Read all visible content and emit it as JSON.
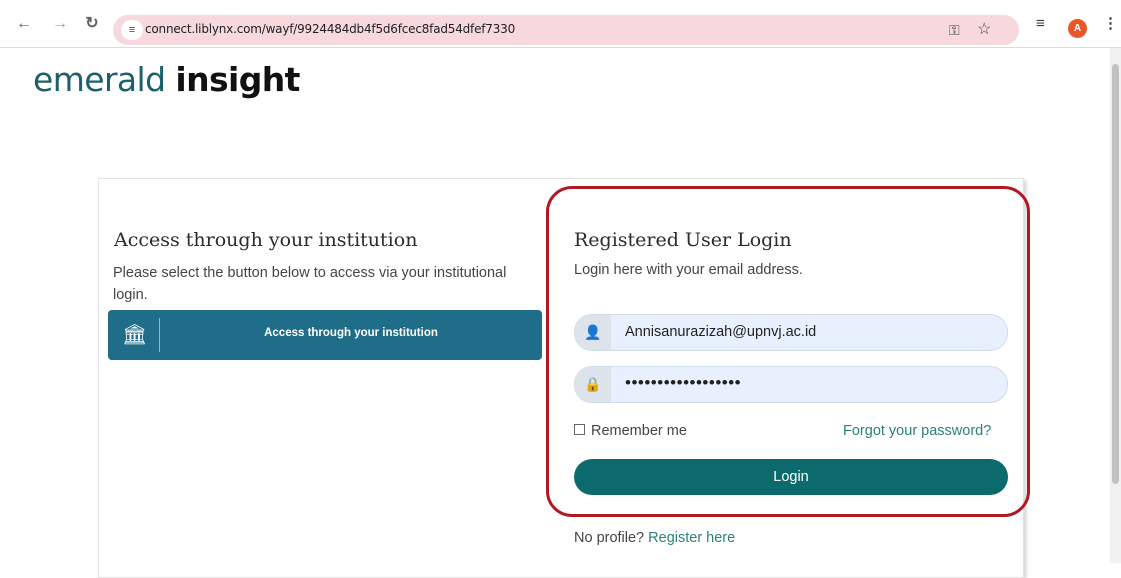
{
  "browser": {
    "url": "connect.liblynx.com/wayf/9924484db4f5d6fcec8fad54dfef7330",
    "avatar_letter": "A",
    "icons": {
      "back": "arrow-left-icon",
      "forward": "arrow-right-icon",
      "reload": "reload-icon",
      "site_info": "tune-icon",
      "password_key": "key-icon",
      "bookmark": "star-icon",
      "media": "media-control-icon",
      "menu": "kebab-menu-icon"
    },
    "colors": {
      "omnibox_bg": "#f6d8dd",
      "avatar": "#e8562a"
    }
  },
  "logo": {
    "light": "emerald",
    "bold": "insight"
  },
  "institution": {
    "title": "Access through your institution",
    "description": "Please select the button below to access via your institutional login.",
    "button_label": "Access through your institution",
    "icon": "institution-building-icon"
  },
  "login": {
    "title": "Registered User Login",
    "description": "Login here with your email address.",
    "email_value": "Annisanurazizah@upnvj.ac.id",
    "password_value": "••••••••••••••••••",
    "remember_label": "Remember me",
    "remember_checked": false,
    "forgot_label": "Forgot your password?",
    "login_button": "Login",
    "no_profile_label": "No profile?",
    "register_label": "Register here"
  },
  "colors": {
    "brand_teal": "#0d6a6c",
    "institution_button": "#1f6d88",
    "link": "#2b8179",
    "highlight_outline": "#b01822"
  }
}
